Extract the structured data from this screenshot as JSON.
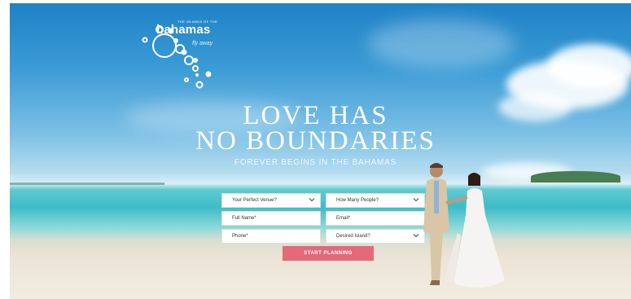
{
  "logo": {
    "top_line": "THE ISLANDS OF THE",
    "wordmark": "bahamas",
    "tagline": "fly away"
  },
  "hero": {
    "headline_line1": "LOVE HAS",
    "headline_line2": "NO BOUNDARIES",
    "subheadline": "FOREVER BEGINS IN THE BAHAMAS"
  },
  "form": {
    "venue_select": "Your Perfect Venue?",
    "people_select": "How Many People?",
    "full_name": "Full Name*",
    "email": "Email*",
    "phone": "Phone*",
    "island_select": "Desired Island?",
    "submit_label": "START PLANNING"
  },
  "colors": {
    "button": "#e3697b",
    "headline": "#ffffff"
  }
}
